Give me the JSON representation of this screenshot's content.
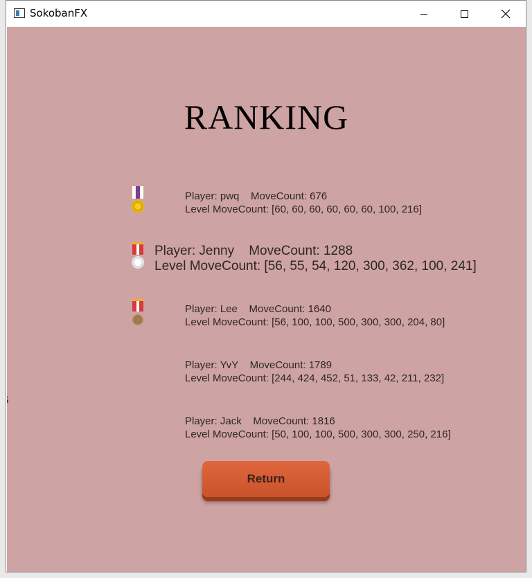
{
  "window": {
    "title": "SokobanFX"
  },
  "side_fragment": "s",
  "heading": "RANKING",
  "entries": [
    {
      "player_line": "Player: pwq    MoveCount: 676",
      "level_line": "Level MoveCount: [60, 60, 60, 60, 60, 60, 100, 216]",
      "medal": "purple-gold-medal-icon"
    },
    {
      "player_line": "Player: Jenny    MoveCount: 1288",
      "level_line": "Level MoveCount: [56, 55, 54, 120, 300, 362, 100, 241]",
      "medal": "red-silver-medal-icon"
    },
    {
      "player_line": "Player: Lee    MoveCount: 1640",
      "level_line": "Level MoveCount: [56, 100, 100, 500, 300, 300, 204, 80]",
      "medal": "red-bronze-medal-icon"
    },
    {
      "player_line": "Player: YvY    MoveCount: 1789",
      "level_line": "Level MoveCount: [244, 424, 452, 51, 133, 42, 211, 232]"
    },
    {
      "player_line": "Player: Jack    MoveCount: 1816",
      "level_line": "Level MoveCount: [50, 100, 100, 500, 300, 300, 250, 216]"
    }
  ],
  "return_button": {
    "label": "Return"
  },
  "colors": {
    "background": "#cea3a3",
    "button": "#d65c34"
  }
}
